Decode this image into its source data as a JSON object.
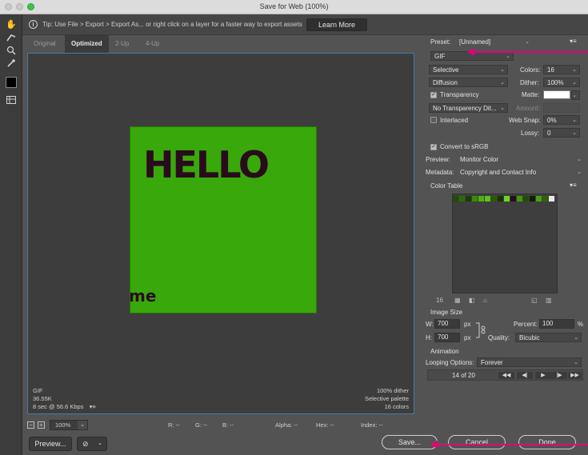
{
  "window": {
    "title": "Save for Web (100%)"
  },
  "tip": {
    "text": "Tip: Use File > Export > Export As...  or right click on a layer for a faster way to export assets",
    "learn_more": "Learn More"
  },
  "tabs": [
    {
      "label": "Original",
      "active": false
    },
    {
      "label": "Optimized",
      "active": true
    },
    {
      "label": "2-Up",
      "active": false
    },
    {
      "label": "4-Up",
      "active": false
    }
  ],
  "artwork": {
    "hello": "HELLO",
    "me": "me"
  },
  "canvas_info": {
    "format": "GIF",
    "size": "36.55K",
    "speed": "8 sec @ 56.6 Kbps",
    "speed_menu_icon": "▾≡",
    "dither": "100% dither",
    "palette": "Selective palette",
    "colors": "16 colors"
  },
  "status": {
    "zoom": "100%",
    "r": "R: --",
    "g": "G: --",
    "b": "B: --",
    "alpha": "Alpha: --",
    "hex": "Hex: --",
    "index": "Index: --"
  },
  "panel": {
    "preset_label": "Preset:",
    "preset_value": "[Unnamed]",
    "format_value": "GIF",
    "reduction_value": "Selective",
    "colors_label": "Colors:",
    "colors_value": "16",
    "dither_algo": "Diffusion",
    "dither_label": "Dither:",
    "dither_value": "100%",
    "transparency_label": "Transparency",
    "transparency_checked": true,
    "matte_label": "Matte:",
    "transparency_dither": "No Transparency Dit...",
    "amount_label": "Amount:",
    "interlaced_label": "Interlaced",
    "interlaced_checked": false,
    "websnap_label": "Web Snap:",
    "websnap_value": "0%",
    "lossy_label": "Lossy:",
    "lossy_value": "0",
    "srgb_label": "Convert to sRGB",
    "srgb_checked": true,
    "preview_label": "Preview:",
    "preview_value": "Monitor Color",
    "metadata_label": "Metadata:",
    "metadata_value": "Copyright and Contact Info",
    "color_table_label": "Color Table",
    "color_table_count": "16",
    "swatches": [
      "#1f4e04",
      "#2d6a07",
      "#1a3d03",
      "#3a8a09",
      "#4fb011",
      "#5ec21a",
      "#2a5c06",
      "#173202",
      "#6ad424",
      "#2b0b20",
      "#3f9a0b",
      "#234d05",
      "#0f1f02",
      "#4a9f0f",
      "#2e6208",
      "#e8e8e8"
    ],
    "image_size_label": "Image Size",
    "w_label": "W:",
    "w_value": "700",
    "h_label": "H:",
    "h_value": "700",
    "px_unit": "px",
    "percent_label": "Percent:",
    "percent_value": "100",
    "percent_unit": "%",
    "quality_label": "Quality:",
    "quality_value": "Bicubic",
    "animation_label": "Animation",
    "looping_label": "Looping Options:",
    "looping_value": "Forever",
    "frame_counter": "14 of 20"
  },
  "bottom": {
    "preview_button": "Preview...",
    "browser_icon": "⊘",
    "save_button": "Save...",
    "cancel_button": "Cancel",
    "done_button": "Done"
  },
  "annotation_color": "#e4007c"
}
